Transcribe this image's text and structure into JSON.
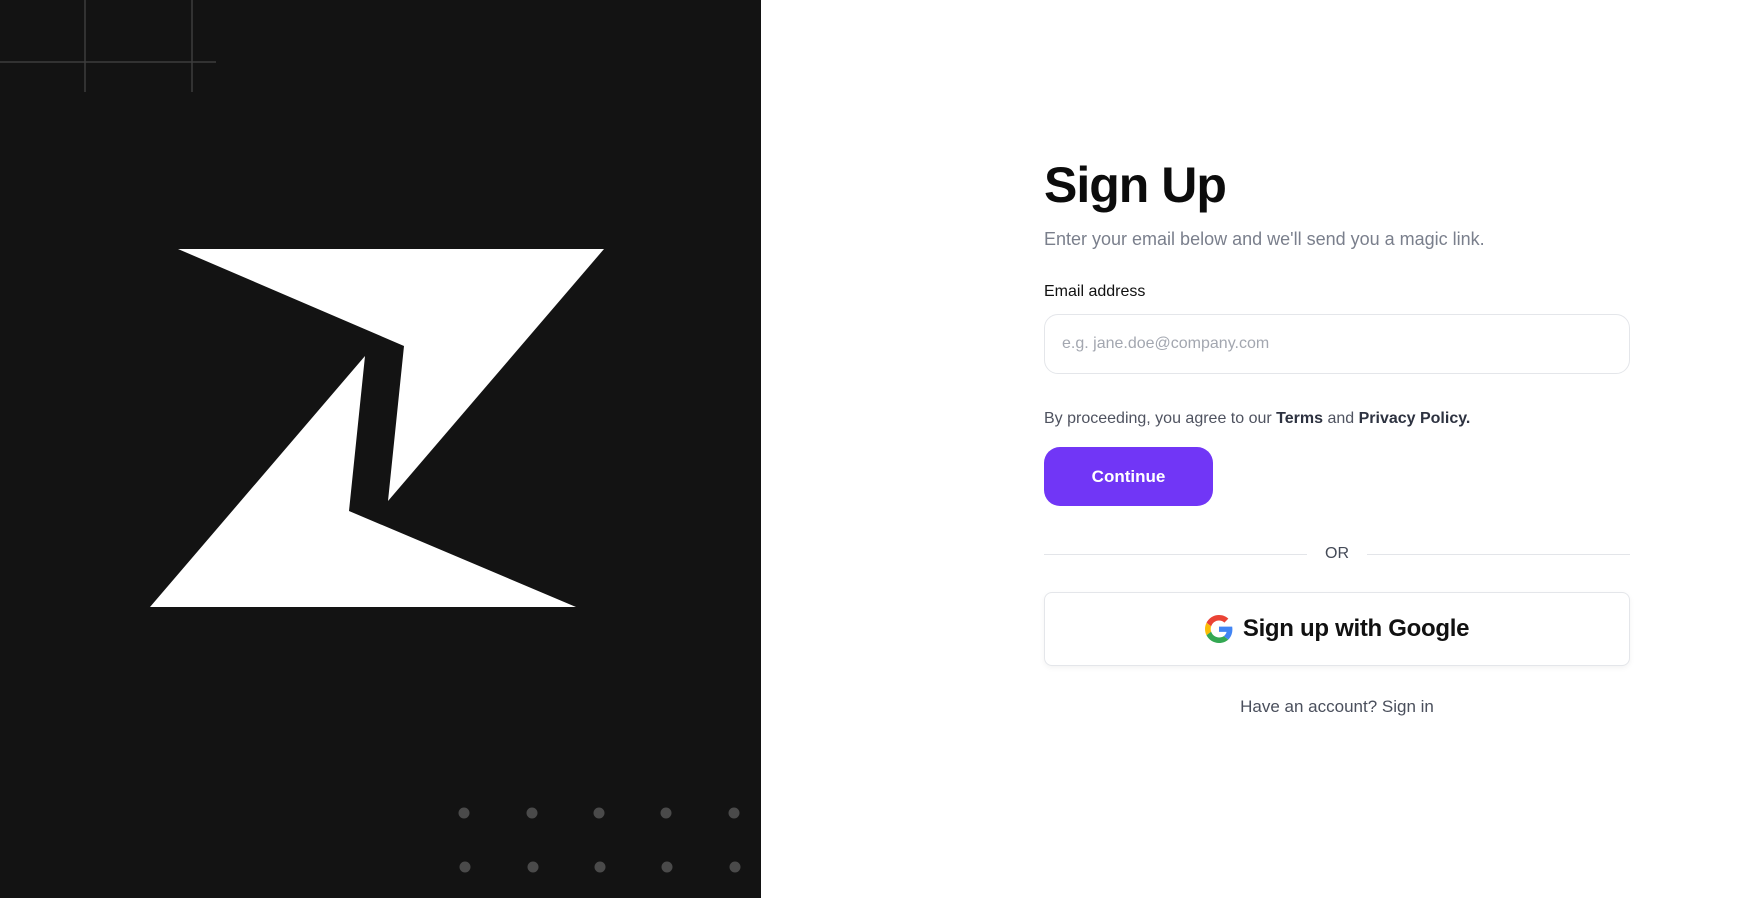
{
  "brand": {
    "background": "#131313",
    "logo_icon": "lightning-z-logo"
  },
  "form": {
    "title": "Sign Up",
    "subtitle": "Enter your email below and we'll send you a magic link.",
    "email_label": "Email address",
    "email_placeholder": "e.g. jane.doe@company.com",
    "email_value": "",
    "consent_prefix": "By proceeding, you agree to our ",
    "terms_label": "Terms",
    "consent_and": " and ",
    "privacy_label": "Privacy Policy.",
    "continue_label": "Continue",
    "divider_label": "OR",
    "google_label": "Sign up with Google",
    "google_icon": "google-icon",
    "signin_prompt": "Have an account? ",
    "signin_label": "Sign in"
  },
  "colors": {
    "accent": "#7136f6",
    "dark_panel": "#131313"
  }
}
